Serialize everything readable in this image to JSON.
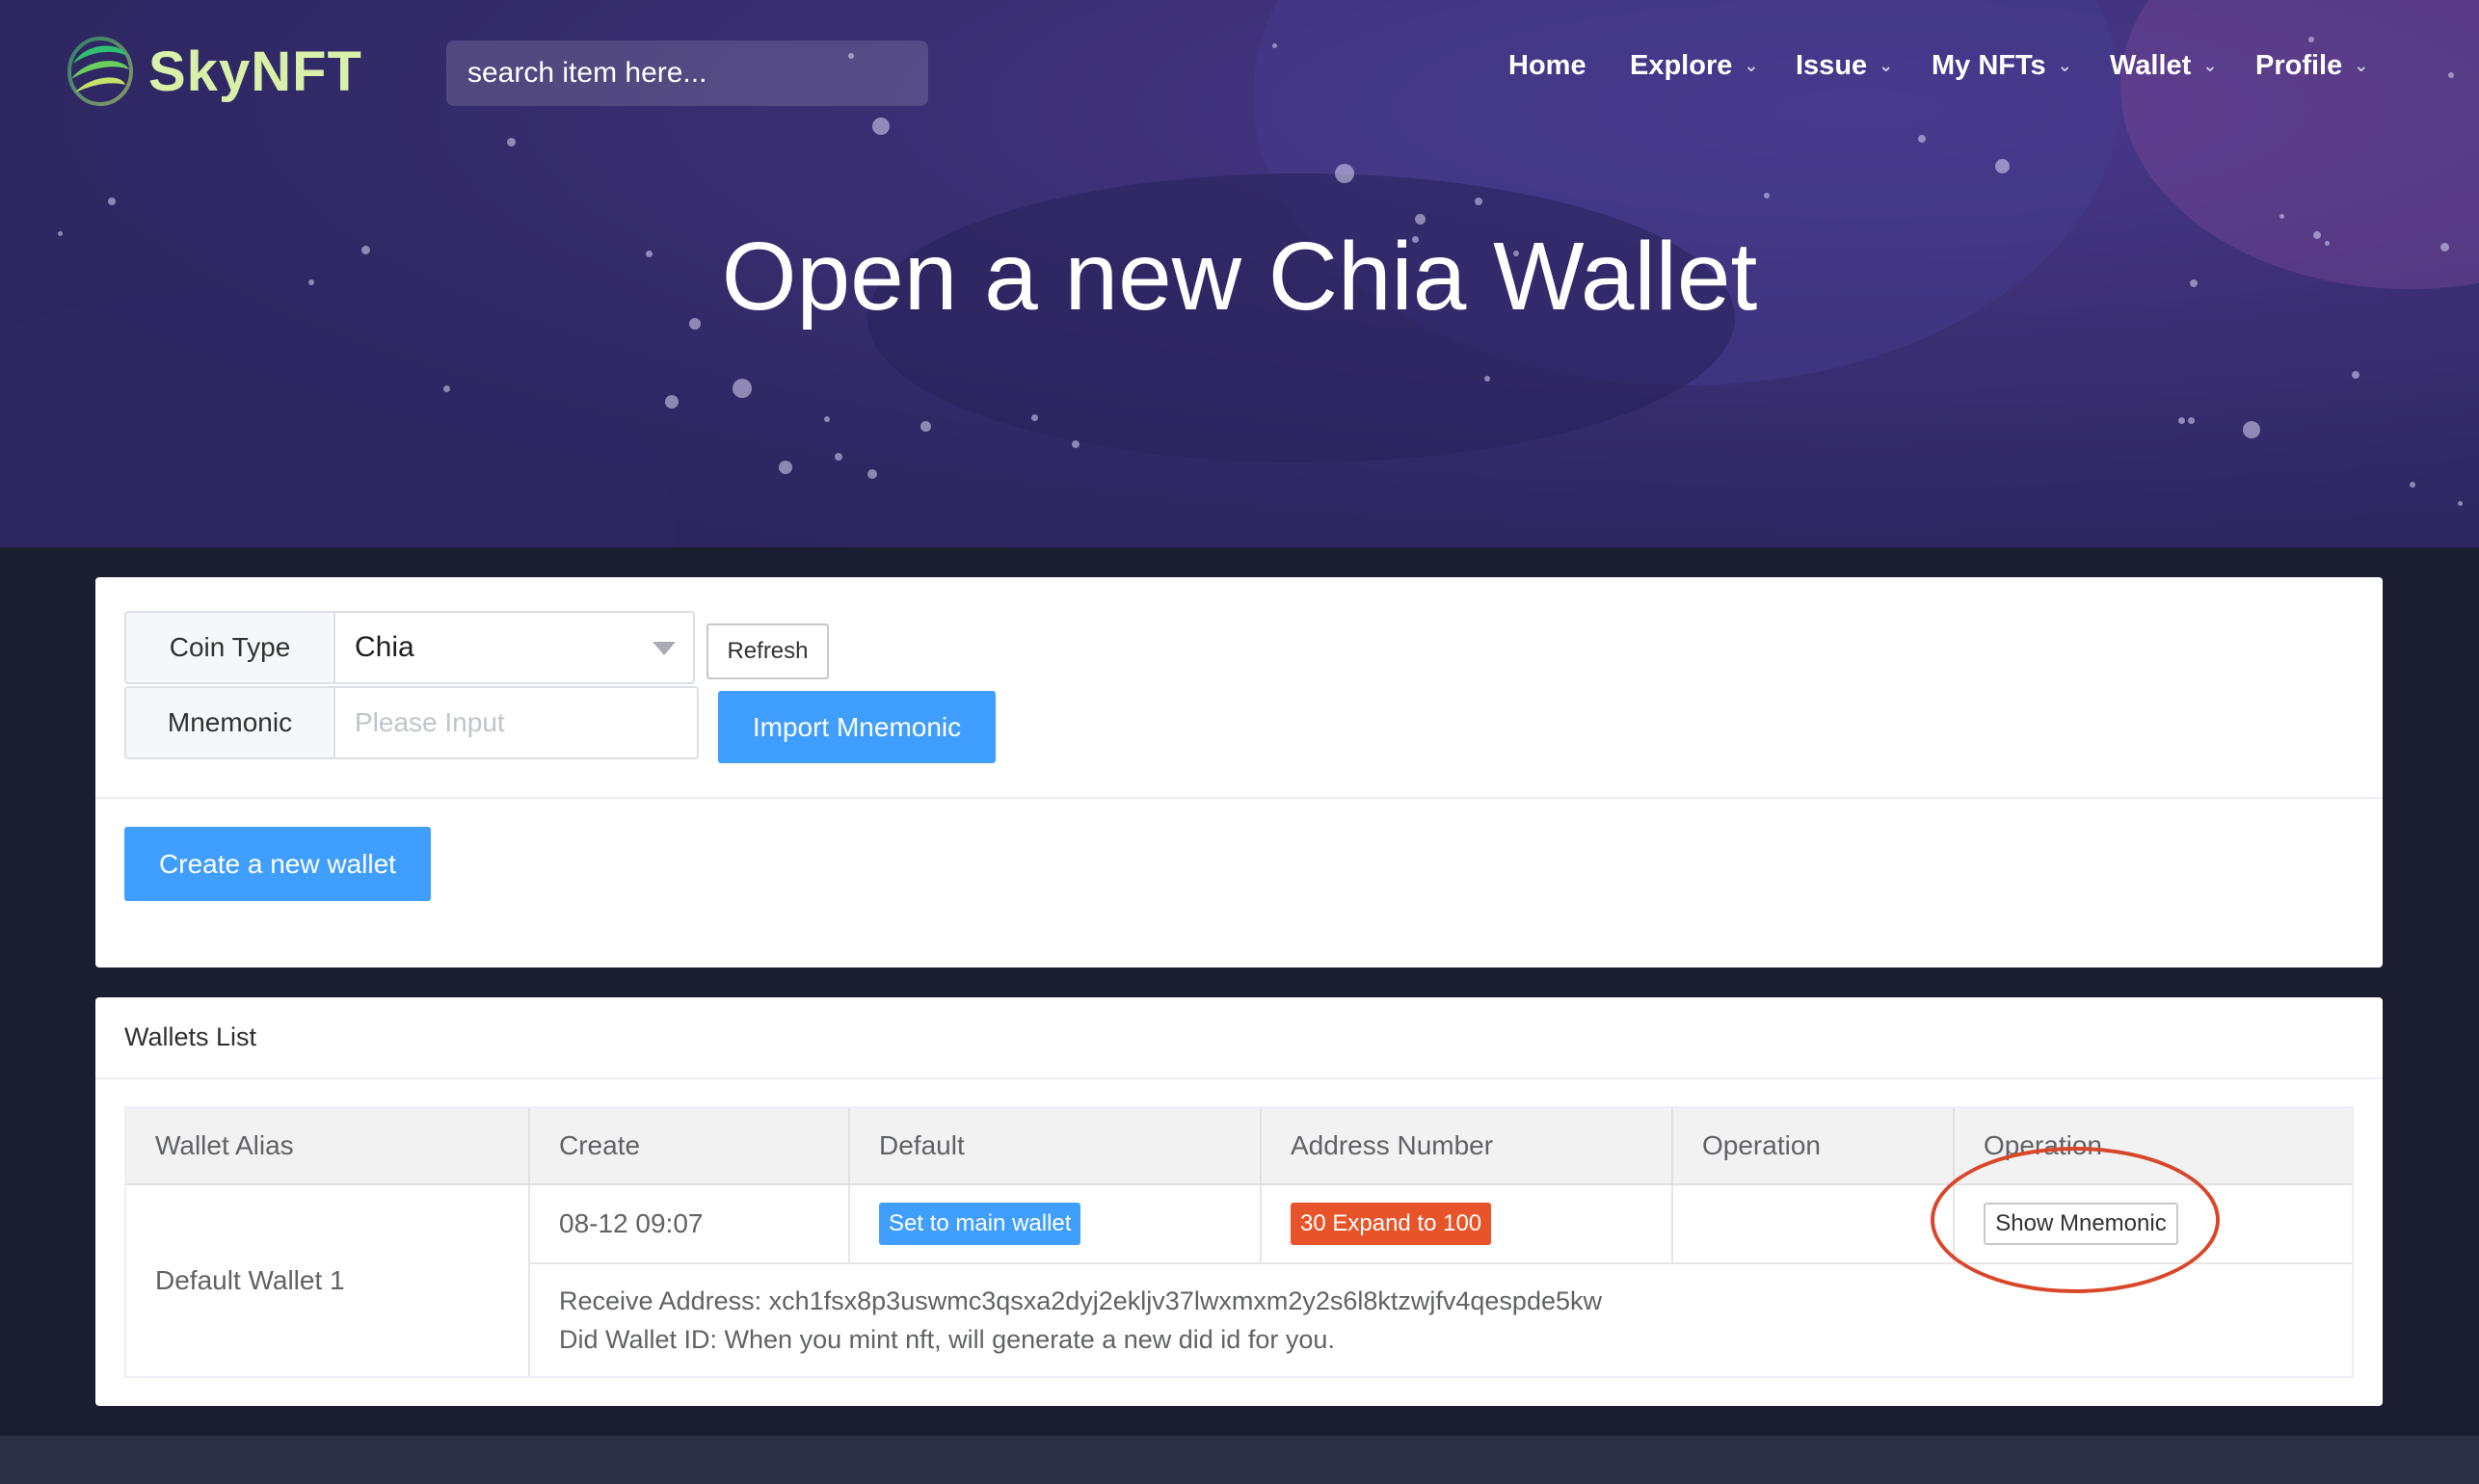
{
  "brand": {
    "name": "SkyNFT"
  },
  "search": {
    "placeholder": "search item here..."
  },
  "nav": {
    "home": "Home",
    "explore": "Explore",
    "issue": "Issue",
    "my_nfts": "My NFTs",
    "wallet": "Wallet",
    "profile": "Profile"
  },
  "hero": {
    "title": "Open a new Chia Wallet"
  },
  "form": {
    "coin_type_label": "Coin Type",
    "coin_type_value": "Chia",
    "refresh_label": "Refresh",
    "mnemonic_label": "Mnemonic",
    "mnemonic_placeholder": "Please Input",
    "import_label": "Import Mnemonic",
    "create_label": "Create a new wallet"
  },
  "wallets": {
    "title": "Wallets List",
    "headers": [
      "Wallet Alias",
      "Create",
      "Default",
      "Address Number",
      "Operation",
      "Operation"
    ],
    "rows": [
      {
        "alias": "Default Wallet 1",
        "create": "08-12 09:07",
        "default_btn": "Set to main wallet",
        "address_btn": "30 Expand to 100",
        "operation": "",
        "show_mnemonic": "Show Mnemonic",
        "receive_address": "Receive Address: xch1fsx8p3uswmc3qsxa2dyj2ekljv37lwxmxm2y2s6l8ktzwjfv4qespde5kw",
        "did_wallet": "Did Wallet ID: When you mint nft, will generate a new did id for you."
      }
    ]
  },
  "colors": {
    "accent": "#409eff",
    "warning": "#e8542a",
    "highlight_circle": "#d9472b",
    "hero_bg": "#2e2762"
  }
}
